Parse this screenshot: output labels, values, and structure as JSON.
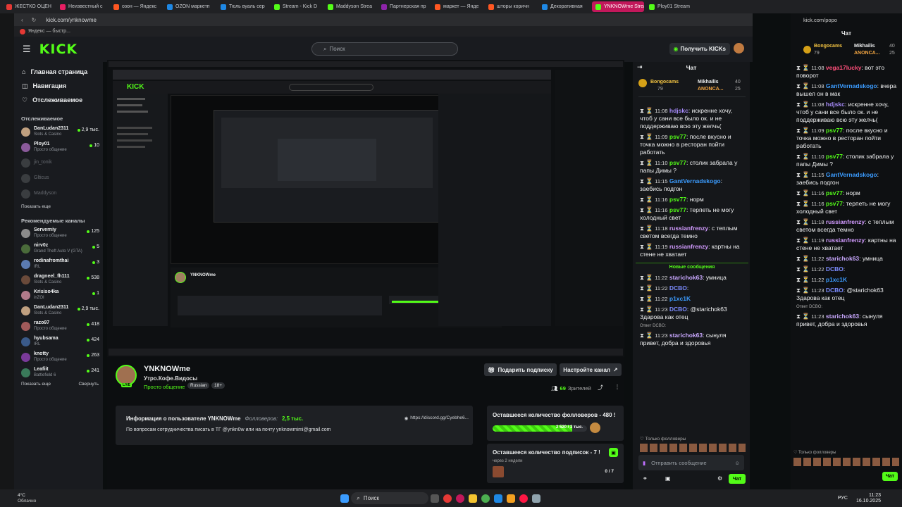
{
  "tabs": [
    {
      "label": "ЖЕСТКО ОЦЕН",
      "color": "#e53935"
    },
    {
      "label": "Неизвестный с",
      "color": "#e91e63"
    },
    {
      "label": "озон — Яндекс",
      "color": "#ff5722"
    },
    {
      "label": "OZON маркетп",
      "color": "#1e88e5"
    },
    {
      "label": "Тюль вуаль сер",
      "color": "#1e88e5"
    },
    {
      "label": "Stream - Kick D",
      "color": "#53fc18"
    },
    {
      "label": "Maddyson Strea",
      "color": "#53fc18"
    },
    {
      "label": "Партнерская пр",
      "color": "#8e24aa"
    },
    {
      "label": "маркет — Янде",
      "color": "#ff5722"
    },
    {
      "label": "шторы коричн",
      "color": "#ff5722"
    },
    {
      "label": "Декоративная",
      "color": "#1e88e5"
    },
    {
      "label": "YNKNOWme Stream - W",
      "color": "#53fc18"
    },
    {
      "label": "Ploy01 Stream",
      "color": "#53fc18"
    }
  ],
  "address": "kick.com/ynknowme",
  "address_right": "kick.com/popo",
  "bookmark": "Яндекс — быстр...",
  "header": {
    "search_placeholder": "Поиск",
    "get_kicks": "Получить KICKs"
  },
  "nav": [
    "Главная страница",
    "Навигация",
    "Отслеживаемое"
  ],
  "followed_title": "Отслеживаемое",
  "followed": [
    {
      "name": "DanLudan2311",
      "sub": "Slots & Casino",
      "viewers": "2,9 тыс.",
      "color": "#c0a080"
    },
    {
      "name": "Ploy01",
      "sub": "Просто общение",
      "viewers": "10",
      "color": "#8a5a9a"
    },
    {
      "name": "jin_tonik",
      "sub": "",
      "viewers": "",
      "color": "#3a3d40"
    },
    {
      "name": "Glticus",
      "sub": "",
      "viewers": "",
      "color": "#3a3d40"
    },
    {
      "name": "Maddyson",
      "sub": "",
      "viewers": "",
      "color": "#3a3d40"
    }
  ],
  "show_more": "Показать еще",
  "recommended_title": "Рекомендуемые каналы",
  "recommended": [
    {
      "name": "Serverniy",
      "sub": "Просто общение",
      "viewers": "125",
      "color": "#8b8b8b"
    },
    {
      "name": "nirv0z",
      "sub": "Grand Theft Auto V (GTA)",
      "viewers": "5",
      "color": "#4a6b3a"
    },
    {
      "name": "rodinafromthai",
      "sub": "IRL",
      "viewers": "3",
      "color": "#5a7ab0"
    },
    {
      "name": "dragneel_fh111",
      "sub": "Slots & Casino",
      "viewers": "538",
      "color": "#6a4a3a"
    },
    {
      "name": "Krisiso4ka",
      "sub": "inZOI",
      "viewers": "1",
      "color": "#b07a8a"
    },
    {
      "name": "DanLudan2311",
      "sub": "Slots & Casino",
      "viewers": "2,9 тыс.",
      "color": "#c0a080"
    },
    {
      "name": "razo97",
      "sub": "Просто общение",
      "viewers": "418",
      "color": "#a05a5a"
    },
    {
      "name": "hyubsama",
      "sub": "IRL",
      "viewers": "424",
      "color": "#3a5a8a"
    },
    {
      "name": "knotty",
      "sub": "Просто общение",
      "viewers": "263",
      "color": "#7a3a9a"
    },
    {
      "name": "Leafiit",
      "sub": "Battlefield 6",
      "viewers": "241",
      "color": "#3a7a5a"
    }
  ],
  "show_more2": "Показать еще",
  "collapse": "Свернуть",
  "channel": {
    "name": "YNKNOWme",
    "title": "Утро.Кофе.Видосы",
    "category": "Просто общение",
    "tags": [
      "Russian",
      "18+"
    ],
    "gift_sub": "Подарить подписку",
    "setup": "Настройте канал",
    "viewers": "69",
    "viewers_label": "Зрителей"
  },
  "about": {
    "title": "Информация о пользователе YNKNOWme",
    "followers_label": "Фолловеров:",
    "followers": "2,5 тыс.",
    "discord": "https://discord.gg/Cyebhe6...",
    "text": "По вопросам сотрудничества писать в ТГ @ynkn0w или на почту ynknowmimi@gmail.com"
  },
  "goals": [
    {
      "title": "Оставшееся количество фолловеров - 480 !",
      "progress_text": "2 520 / 3 тыс.",
      "fill": 0.84
    },
    {
      "title": "Оставшееся количество подписок - 7 !",
      "sub": "через 2 недели",
      "count": "0 / 7"
    }
  ],
  "chat": {
    "title": "Чат",
    "pinned": [
      {
        "name": "Bongocams",
        "count": "79"
      },
      {
        "name": "Mikhailis",
        "count": "40"
      },
      {
        "name": "ANONCA...",
        "count": "25"
      }
    ],
    "messages": [
      {
        "time": "11:08",
        "user": "hdjskc",
        "color": "#a78bfa",
        "text": ": искренне хочу, чтоб у сани все было ок. и не поддерживаю всю эту желчь("
      },
      {
        "time": "11:09",
        "user": "psv77",
        "color": "#53fc18",
        "text": ": после вкусно и точка можно в ресторан пойти работать"
      },
      {
        "time": "11:10",
        "user": "psv77",
        "color": "#53fc18",
        "text": ": столик забрала у папы Димы ?"
      },
      {
        "time": "11:15",
        "user": "GantVernadskogo",
        "color": "#3b9cff",
        "text": ": заебись подгон"
      },
      {
        "time": "11:16",
        "user": "psv77",
        "color": "#53fc18",
        "text": ": норм"
      },
      {
        "time": "11:16",
        "user": "psv77",
        "color": "#53fc18",
        "text": ": терпеть не могу холодный свет"
      },
      {
        "time": "11:18",
        "user": "russianfrenzy",
        "color": "#d29bff",
        "text": ": с теплым светом всегда темно"
      },
      {
        "time": "11:19",
        "user": "russianfrenzy",
        "color": "#d29bff",
        "text": ": картны на стене не хватает"
      }
    ],
    "new_messages": "Новые сообщения",
    "messages2": [
      {
        "time": "11:22",
        "user": "starichok63",
        "color": "#c9a8ff",
        "text": ": умница"
      },
      {
        "time": "11:22",
        "user": "DCBO",
        "color": "#7c8cff",
        "text": ":"
      },
      {
        "time": "11:22",
        "user": "p1xc1K",
        "color": "#3b9cff",
        "text": ""
      },
      {
        "time": "11:23",
        "user": "DCBO",
        "color": "#7c8cff",
        "text": ": @starichok63 Здарова как отец"
      },
      {
        "time": "11:23",
        "user": "starichok63",
        "color": "#c9a8ff",
        "text": ": сынуля привет, добра и здоровья",
        "reply": "Ответ DCBO:"
      }
    ],
    "followers_only": "Только фолловеры",
    "input_placeholder": "Отправить сообщение",
    "send": "Чат"
  },
  "right_window": {
    "title": "Чат",
    "top_messages": [
      {
        "time": "11:08",
        "user": "vega17lucky",
        "color": "#ff4f7a",
        "text": ": вот это поворот"
      },
      {
        "time": "11:08",
        "user": "GantVernadskogo",
        "color": "#3b9cff",
        "text": ": вчера вышел он в мак"
      }
    ]
  },
  "taskbar": {
    "weather_temp": "4°C",
    "weather_desc": "Облачно",
    "search": "Поиск",
    "lang": "РУС",
    "time": "11:23",
    "date": "16.10.2025"
  }
}
